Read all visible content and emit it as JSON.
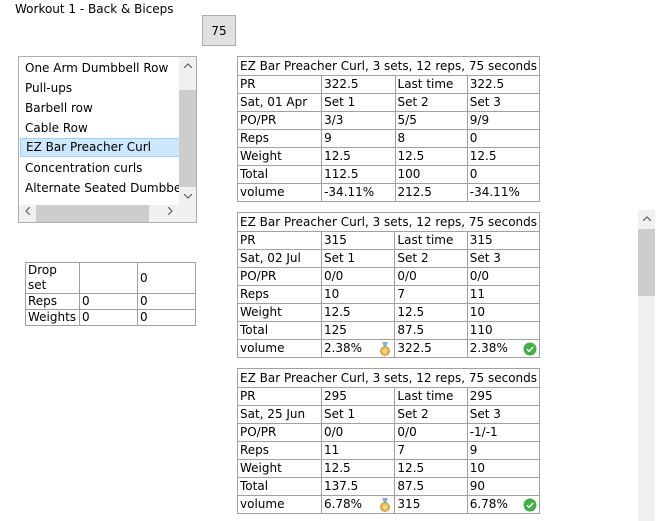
{
  "window": {
    "title": "Workout 1 - Back & Biceps"
  },
  "counter": {
    "value": "75"
  },
  "exercise_list": {
    "items": [
      "One Arm Dumbbell Row",
      "Pull-ups",
      "Barbell row",
      "Cable Row",
      "EZ Bar Preacher Curl",
      "Concentration curls",
      "Alternate Seated Dumbbell Curl"
    ],
    "selected_index": 4
  },
  "drop_set": {
    "rows": [
      [
        "Drop set",
        "",
        "0"
      ],
      [
        "Reps",
        "0",
        "0"
      ],
      [
        "Weights",
        "0",
        "0"
      ]
    ]
  },
  "sessions": [
    {
      "header": "EZ Bar Preacher Curl, 3 sets, 12 reps, 75 seconds",
      "pr_row": [
        "PR",
        "322.5",
        "Last time",
        "322.5"
      ],
      "date_row": [
        "Sat, 01 Apr",
        "Set 1",
        "Set 2",
        "Set 3"
      ],
      "popr_row": [
        "PO/PR",
        "3/3",
        "5/5",
        "9/9"
      ],
      "reps_row": [
        "Reps",
        "9",
        "8",
        "0"
      ],
      "weight_row": [
        "Weight",
        "12.5",
        "12.5",
        "12.5"
      ],
      "total_row": [
        "Total",
        "112.5",
        "100",
        "0"
      ],
      "volume_row": [
        "volume",
        "-34.11%",
        "212.5",
        "-34.11%"
      ],
      "medal": false,
      "check": false
    },
    {
      "header": "EZ Bar Preacher Curl, 3 sets, 12 reps, 75 seconds",
      "pr_row": [
        "PR",
        "315",
        "Last time",
        "315"
      ],
      "date_row": [
        "Sat, 02 Jul",
        "Set 1",
        "Set 2",
        "Set 3"
      ],
      "popr_row": [
        "PO/PR",
        "0/0",
        "0/0",
        "0/0"
      ],
      "reps_row": [
        "Reps",
        "10",
        "7",
        "11"
      ],
      "weight_row": [
        "Weight",
        "12.5",
        "12.5",
        "10"
      ],
      "total_row": [
        "Total",
        "125",
        "87.5",
        "110"
      ],
      "volume_row": [
        "volume",
        "2.38%",
        "322.5",
        "2.38%"
      ],
      "medal": true,
      "check": true
    },
    {
      "header": "EZ Bar Preacher Curl, 3 sets, 12 reps, 75 seconds",
      "pr_row": [
        "PR",
        "295",
        "Last time",
        "295"
      ],
      "date_row": [
        "Sat, 25 Jun",
        "Set 1",
        "Set 2",
        "Set 3"
      ],
      "popr_row": [
        "PO/PR",
        "0/0",
        "0/0",
        "-1/-1"
      ],
      "reps_row": [
        "Reps",
        "11",
        "7",
        "9"
      ],
      "weight_row": [
        "Weight",
        "12.5",
        "12.5",
        "10"
      ],
      "total_row": [
        "Total",
        "137.5",
        "87.5",
        "90"
      ],
      "volume_row": [
        "volume",
        "6.78%",
        "315",
        "6.78%"
      ],
      "medal": true,
      "check": true
    }
  ],
  "colors": {
    "selection_bg": "#cce8ff",
    "selection_border": "#99d1ff",
    "grid_border": "#a0a0a0",
    "check_green": "#3cb043",
    "medal_gold": "#e8b84a"
  },
  "icons": {
    "medal": "medal-icon",
    "check": "check-circle-icon",
    "scroll_up": "chevron-up-icon",
    "scroll_down": "chevron-down-icon",
    "scroll_left": "chevron-left-icon",
    "scroll_right": "chevron-right-icon"
  }
}
